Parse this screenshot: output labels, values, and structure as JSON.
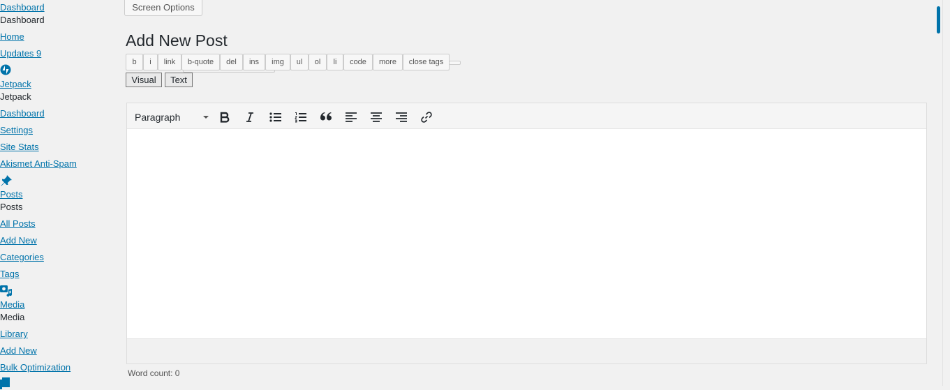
{
  "sidebar": {
    "items": [
      {
        "label": "Dashboard",
        "link": true
      },
      {
        "label": "Dashboard",
        "link": false
      },
      {
        "label": "Home",
        "link": true
      },
      {
        "label": "Updates 9",
        "link": true
      },
      {
        "label": "Jetpack",
        "link": true
      },
      {
        "label": "Jetpack",
        "link": false
      },
      {
        "label": "Dashboard",
        "link": true
      },
      {
        "label": "Settings",
        "link": true
      },
      {
        "label": "Site Stats",
        "link": true
      },
      {
        "label": "Akismet Anti-Spam",
        "link": true
      },
      {
        "label": "Posts",
        "link": true
      },
      {
        "label": "Posts",
        "link": false
      },
      {
        "label": "All Posts",
        "link": true
      },
      {
        "label": "Add New",
        "link": true
      },
      {
        "label": "Categories",
        "link": true
      },
      {
        "label": "Tags",
        "link": true
      },
      {
        "label": "Media",
        "link": true
      },
      {
        "label": "Media",
        "link": false
      },
      {
        "label": "Library",
        "link": true
      },
      {
        "label": "Add New",
        "link": true
      },
      {
        "label": "Bulk Optimization",
        "link": true
      }
    ],
    "icons": [
      "jetpack-icon",
      "pushpin-icon",
      "media-icon",
      "pages-icon"
    ]
  },
  "screen_options": {
    "label": "Screen Options"
  },
  "page": {
    "title": "Add New Post"
  },
  "quicktags": {
    "buttons": [
      "b",
      "i",
      "link",
      "b-quote",
      "del",
      "ins",
      "img",
      "ul",
      "ol",
      "li",
      "code",
      "more",
      "close tags"
    ]
  },
  "editor_tabs": {
    "visual": "Visual",
    "text": "Text"
  },
  "mce_toolbar": {
    "format": "Paragraph",
    "buttons": [
      "bold-icon",
      "italic-icon",
      "bullet-list-icon",
      "numbered-list-icon",
      "blockquote-icon",
      "align-left-icon",
      "align-center-icon",
      "align-right-icon",
      "link-icon"
    ]
  },
  "status": {
    "word_count": "Word count: 0"
  },
  "colors": {
    "link": "#0073aa",
    "accent": "#0073aa",
    "background": "#f1f1f1"
  }
}
